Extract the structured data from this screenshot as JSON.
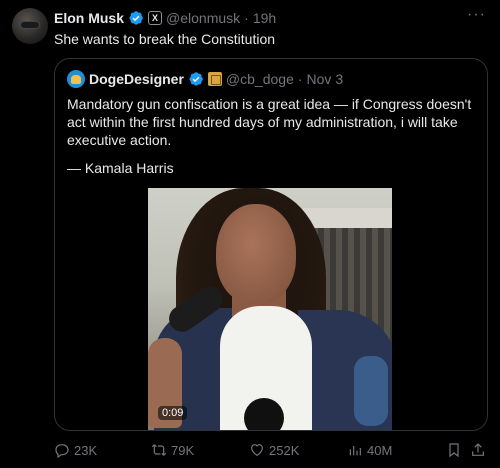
{
  "tweet": {
    "author_name": "Elon Musk",
    "handle": "@elonmusk",
    "separator": "·",
    "time": "19h",
    "text": "She wants to break the Constitution"
  },
  "quote": {
    "author_name": "DogeDesigner",
    "handle": "@cb_doge",
    "separator": "·",
    "time": "Nov 3",
    "text": "Mandatory gun confiscation is a great idea — if Congress doesn't act within the first hundred days of my administration, i will take executive action.",
    "attribution": "— Kamala Harris",
    "video_duration": "0:09"
  },
  "actions": {
    "replies": "23K",
    "reposts": "79K",
    "likes": "252K",
    "views": "40M"
  },
  "colors": {
    "background": "#000000",
    "text": "#e7e9ea",
    "muted": "#71767b",
    "verified": "#1d9bf0",
    "border": "#2f3336"
  },
  "icons": [
    "more-icon",
    "verified-icon",
    "x-badge-icon",
    "reply-icon",
    "repost-icon",
    "like-icon",
    "views-icon",
    "bookmark-icon",
    "share-icon"
  ]
}
